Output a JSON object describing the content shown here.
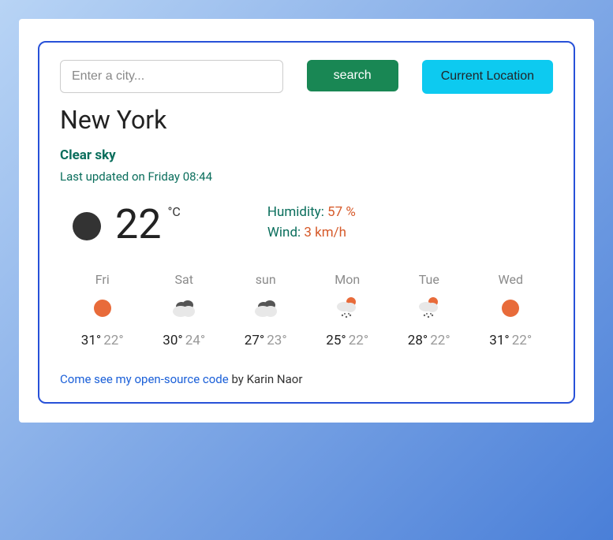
{
  "search": {
    "placeholder": "Enter a city...",
    "search_label": "search",
    "location_label": "Current Location"
  },
  "city": "New York",
  "condition": "Clear sky",
  "updated_prefix": "Last updated on ",
  "updated_time": "Friday 08:44",
  "current": {
    "temp": "22",
    "unit": "°C",
    "humidity_label": "Humidity:",
    "humidity_value": "57 %",
    "wind_label": "Wind:",
    "wind_value": "3 km/h"
  },
  "forecast": [
    {
      "day": "Fri",
      "icon": "sun",
      "hi": "31°",
      "lo": "22°"
    },
    {
      "day": "Sat",
      "icon": "cloud",
      "hi": "30°",
      "lo": "24°"
    },
    {
      "day": "sun",
      "icon": "cloud",
      "hi": "27°",
      "lo": "23°"
    },
    {
      "day": "Mon",
      "icon": "rain-sun",
      "hi": "25°",
      "lo": "22°"
    },
    {
      "day": "Tue",
      "icon": "rain-sun",
      "hi": "28°",
      "lo": "22°"
    },
    {
      "day": "Wed",
      "icon": "sun",
      "hi": "31°",
      "lo": "22°"
    }
  ],
  "footer": {
    "link_text": "Come see my open-source code",
    "author_text": " by Karin Naor"
  }
}
